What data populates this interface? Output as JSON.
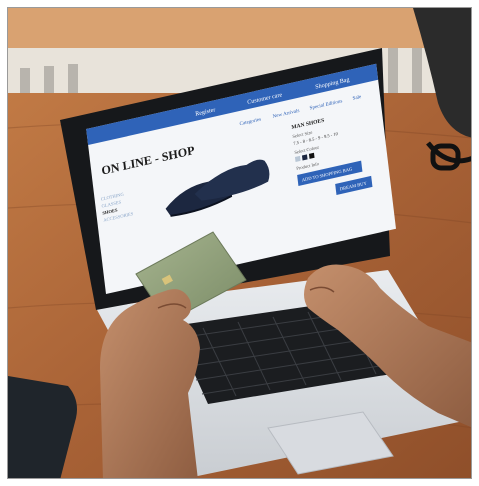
{
  "shop": {
    "top_bar": {
      "register": "Register",
      "customer_care": "Customer care",
      "shopping_bag": "Shopping Bag"
    },
    "title": "ON LINE - SHOP",
    "nav": [
      "Categories",
      "New Arrivals",
      "Special Editions",
      "Sale"
    ],
    "sidebar": [
      "CLOTHING",
      "GLASSES",
      "SHOES",
      "ACCESSORIES"
    ],
    "product": {
      "name": "MAN SHOES",
      "size_label": "Select Size",
      "sizes": "7.5 - 8 - 8.5 - 9 - 9.5 - 10",
      "color_label": "Select Colour",
      "info_label": "Product Info"
    },
    "buttons": {
      "add_to_bag": "ADD TO SHOPPING BAG",
      "buy": "DREAM BUY"
    }
  },
  "colors": {
    "screen_blue": "#2f63b8",
    "shop_bg": "#f4f6f9",
    "table_wood": "#b06a3c",
    "card_green": "#8c9d78"
  }
}
